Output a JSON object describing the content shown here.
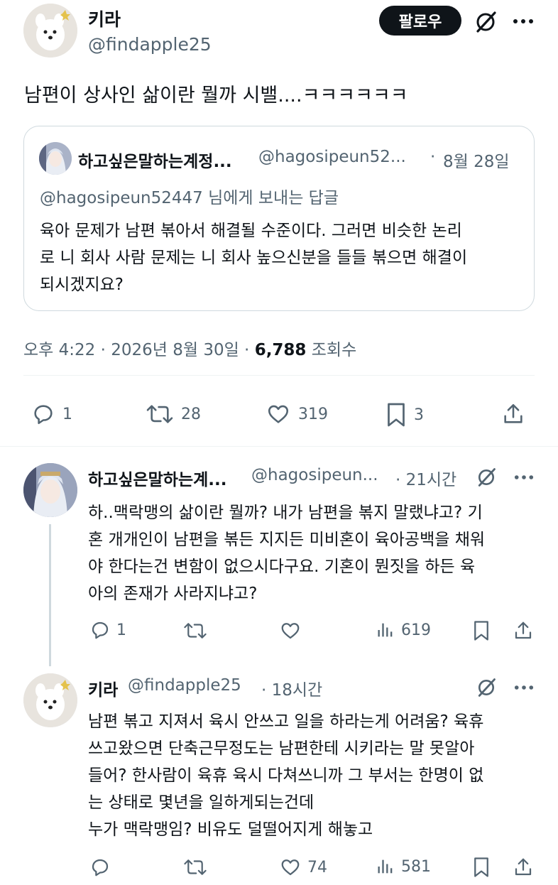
{
  "main_tweet": {
    "display_name": "키라",
    "handle": "@findapple25",
    "follow_label": "팔로우",
    "text": "남편이 상사인 삶이란 뭘까 시밸....ㅋㅋㅋㅋㅋㅋ",
    "quoted": {
      "display_name": "하고싶은말하는계정...",
      "handle": "@hagosipeun52...",
      "sep": "·",
      "date": "8월 28일",
      "reply_to": "@hagosipeun52447 님에게 보내는 답글",
      "text_lines": [
        "육아 문제가 남편 볶아서 해결될 수준이다. 그러면 비슷한 논리",
        "로 니 회사 사람 문제는 니 회사 높으신분을 들들 볶으면 해결이",
        "되시겠지요?"
      ]
    },
    "meta": {
      "time_date": "오후 4:22 · 2026년 8월 30일 ·",
      "views": "6,788",
      "views_label": "조회수"
    },
    "actions": {
      "replies": "1",
      "retweets": "28",
      "likes": "319",
      "bookmarks": "3"
    }
  },
  "replies": [
    {
      "display_name": "하고싶은말하는계...",
      "handle": "@hagosipeun...",
      "time": "· 21시간",
      "text_lines": [
        "하..맥락맹의 삶이란 뭘까? 내가 남편을 볶지 말랬냐고? 기",
        "혼 개개인이 남편을 볶든 지지든 미비혼이 육아공백을 채워",
        "야 한다는건 변함이 없으시다구요. 기혼이 뭔짓을 하든 육",
        "아의 존재가 사라지냐고?"
      ],
      "replies": "1",
      "retweets": "",
      "likes": "",
      "views": "619"
    },
    {
      "display_name": "키라",
      "handle": "@findapple25",
      "time": "· 18시간",
      "text_lines": [
        "남편 볶고 지져서 육시 안쓰고 일을 하라는게 어려움? 육휴",
        "쓰고왔으면 단축근무정도는 남편한테 시키라는 말 못알아",
        "들어? 한사람이 육휴 육시 다쳐쓰니까 그 부서는 한명이 없",
        "는 상태로 몇년을 일하게되는건데",
        "누가 맥락맹임? 비유도 덜떨어지게 해놓고"
      ],
      "replies": "",
      "retweets": "",
      "likes": "74",
      "views": "581"
    }
  ],
  "colors": {
    "text": "#0f1419",
    "muted": "#536471",
    "border": "#cfd9de",
    "divider": "#eff3f4",
    "follow_bg": "#0f1419"
  }
}
